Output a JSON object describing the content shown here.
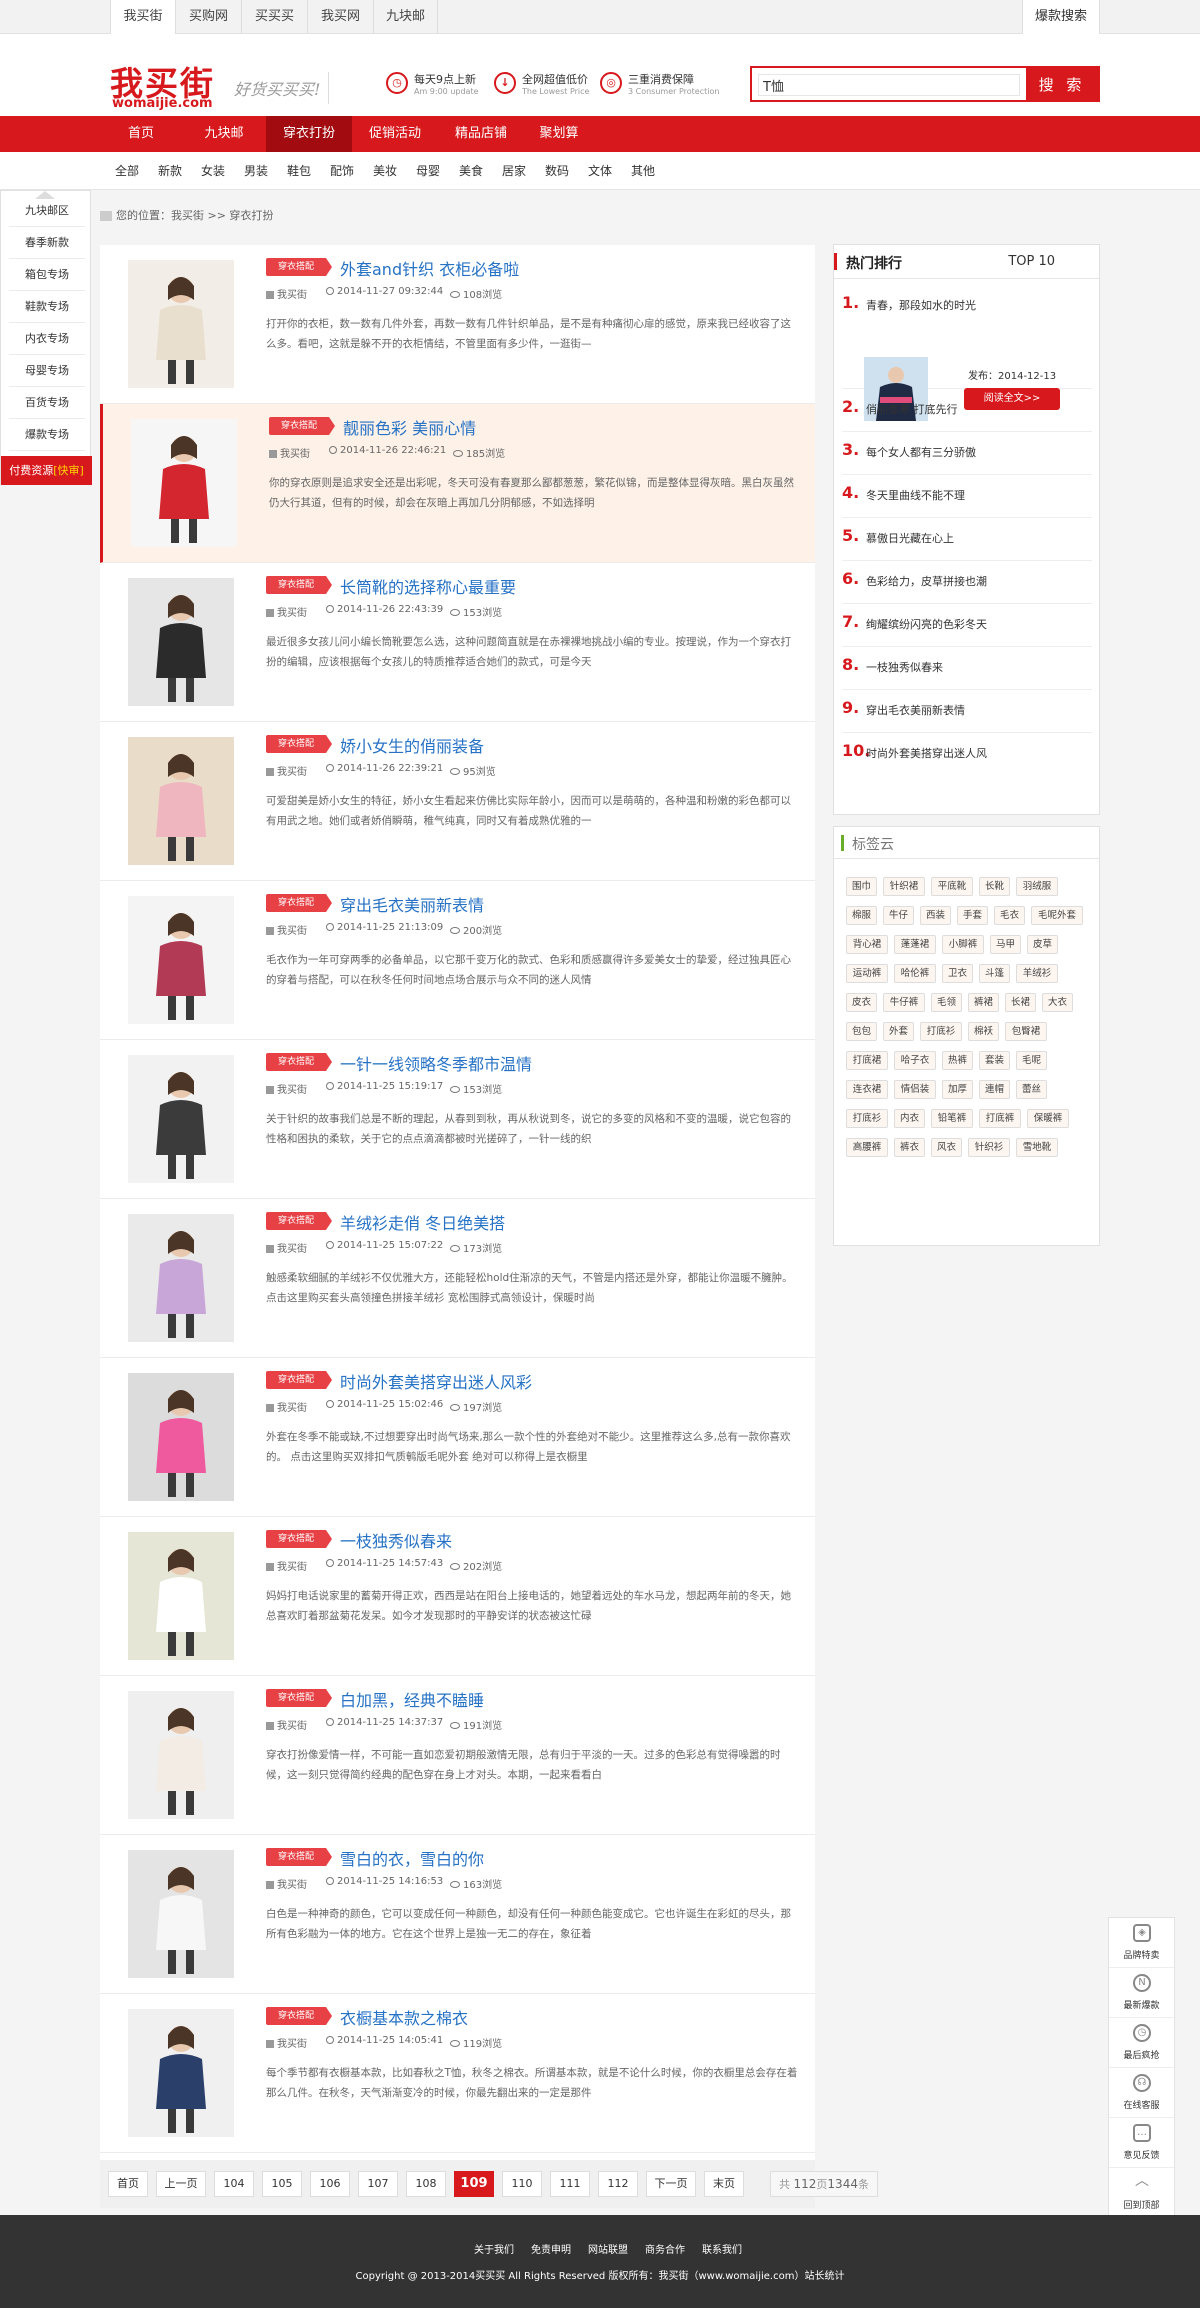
{
  "topbar": {
    "sites": [
      "我买街",
      "买购网",
      "买买买",
      "我买网",
      "九块邮"
    ],
    "hot_search": "爆款搜索"
  },
  "header": {
    "logo_cn": "我买街",
    "logo_en": "womaijie.com",
    "slogan": "好货买买买!",
    "features": [
      {
        "icon": "clock-icon",
        "title": "每天9点上新",
        "sub": "Am 9:00 update"
      },
      {
        "icon": "price-down-icon",
        "title": "全网超值低价",
        "sub": "The Lowest Price"
      },
      {
        "icon": "shield-icon",
        "title": "三重消费保障",
        "sub": "3 Consumer Protection"
      }
    ],
    "search_value": "T恤",
    "search_button": "搜 索"
  },
  "nav": {
    "items": [
      "首页",
      "九块邮",
      "穿衣打扮",
      "促销活动",
      "精品店铺",
      "聚划算"
    ],
    "active_index": 2
  },
  "subnav": [
    "全部",
    "新款",
    "女装",
    "男装",
    "鞋包",
    "配饰",
    "美妆",
    "母婴",
    "美食",
    "居家",
    "数码",
    "文体",
    "其他"
  ],
  "leftfloat": {
    "items": [
      "九块邮区",
      "春季新款",
      "箱包专场",
      "鞋款专场",
      "内衣专场",
      "母婴专场",
      "百货专场",
      "爆款专场"
    ],
    "bottom": "付费资源",
    "bottom_tag": "[快审]"
  },
  "breadcrumb": "您的位置：我买街 >> 穿衣打扮",
  "articles": [
    {
      "badge": "穿衣搭配",
      "title": "外套and针织 衣柜必备啦",
      "author": "我买街",
      "date": "2014-11-27 09:32:44",
      "views": "108浏览",
      "desc": "打开你的衣柜，数一数有几件外套，再数一数有几件针织单品，是不是有种痛彻心扉的感觉，原来我已经收容了这么多。看吧，这就是躲不开的衣柜情结，不管里面有多少件，一逛街—"
    },
    {
      "badge": "穿衣搭配",
      "title": "靓丽色彩 美丽心情",
      "author": "我买街",
      "date": "2014-11-26 22:46:21",
      "views": "185浏览",
      "desc": "你的穿衣原则是追求安全还是出彩呢，冬天可没有春夏那么鄙都葱葱，繁花似锦，而是整体显得灰暗。黑白灰虽然仍大行其道，但有的时候，却会在灰暗上再加几分阴郁感，不如选择明"
    },
    {
      "badge": "穿衣搭配",
      "title": "长筒靴的选择称心最重要",
      "author": "我买街",
      "date": "2014-11-26 22:43:39",
      "views": "153浏览",
      "desc": "最近很多女孩儿问小编长筒靴要怎么选，这种问题简直就是在赤裸裸地挑战小编的专业。按理说，作为一个穿衣打扮的编辑，应该根据每个女孩儿的特质推荐适合她们的款式，可是今天"
    },
    {
      "badge": "穿衣搭配",
      "title": "娇小女生的俏丽装备",
      "author": "我买街",
      "date": "2014-11-26 22:39:21",
      "views": "95浏览",
      "desc": "可爱甜美是娇小女生的特征，娇小女生看起来仿佛比实际年龄小，因而可以是萌萌的，各种温和粉嫩的彩色都可以有用武之地。她们或者娇俏瞬萌，稚气纯真，同时又有着成熟优雅的一"
    },
    {
      "badge": "穿衣搭配",
      "title": "穿出毛衣美丽新表情",
      "author": "我买街",
      "date": "2014-11-25 21:13:09",
      "views": "200浏览",
      "desc": "毛衣作为一年可穿两季的必备单品，以它那千变万化的款式、色彩和质感赢得许多爱美女士的挚爱，经过独具匠心的穿着与搭配，可以在秋冬任何时间地点场合展示与众不同的迷人风情"
    },
    {
      "badge": "穿衣搭配",
      "title": "一针一线领略冬季都市温情",
      "author": "我买街",
      "date": "2014-11-25 15:19:17",
      "views": "153浏览",
      "desc": "关于针织的故事我们总是不断的理起，从春到到秋，再从秋说到冬，说它的多变的风格和不变的温暖，说它包容的性格和困执的柔软，关于它的点点滴滴都被时光搓碎了，一针一线的织"
    },
    {
      "badge": "穿衣搭配",
      "title": "羊绒衫走俏 冬日绝美搭",
      "author": "我买街",
      "date": "2014-11-25 15:07:22",
      "views": "173浏览",
      "desc": "触感柔软细腻的羊绒衫不仅优雅大方，还能轻松hold住渐凉的天气，不管是内搭还是外穿，都能让你温暖不臃肿。 点击这里购买套头高领撞色拼接羊绒衫 宽松围脖式高领设计，保暖时尚"
    },
    {
      "badge": "穿衣搭配",
      "title": "时尚外套美搭穿出迷人风彩",
      "author": "我买街",
      "date": "2014-11-25 15:02:46",
      "views": "197浏览",
      "desc": "外套在冬季不能或缺,不过想要穿出时尚气场来,那么一款个性的外套绝对不能少。这里推荐这么多,总有一款你喜欢的。 点击这里购买双排扣气质鹌版毛呢外套 绝对可以称得上是衣橱里"
    },
    {
      "badge": "穿衣搭配",
      "title": "一枝独秀似春来",
      "author": "我买街",
      "date": "2014-11-25 14:57:43",
      "views": "202浏览",
      "desc": "妈妈打电话说家里的蓄菊开得正欢，西西是站在阳台上接电话的，她望着远处的车水马龙，想起两年前的冬天，她总喜欢盯着那盆菊花发呆。如今才发现那时的平静安详的状态被这忙碌"
    },
    {
      "badge": "穿衣搭配",
      "title": "白加黑，经典不瞌睡",
      "author": "我买街",
      "date": "2014-11-25 14:37:37",
      "views": "191浏览",
      "desc": "穿衣打扮像爱情一样，不可能一直如恋爱初期般激情无限，总有归于平淡的一天。过多的色彩总有觉得噪嚣的时候，这一刻只觉得简约经典的配色穿在身上才对头。本期，一起来看看白"
    },
    {
      "badge": "穿衣搭配",
      "title": "雪白的衣，雪白的你",
      "author": "我买街",
      "date": "2014-11-25 14:16:53",
      "views": "163浏览",
      "desc": "白色是一种神奇的颜色，它可以变成任何一种颜色，却没有任何一种颜色能变成它。它也许诞生在彩虹的尽头，那所有色彩融为一体的地方。它在这个世界上是独一无二的存在，象征着"
    },
    {
      "badge": "穿衣搭配",
      "title": "衣橱基本款之棉衣",
      "author": "我买街",
      "date": "2014-11-25 14:05:41",
      "views": "119浏览",
      "desc": "每个季节都有衣橱基本款，比如春秋之T恤，秋冬之棉衣。所谓基本款，就是不论什么时候，你的衣橱里总会存在着那么几件。在秋冬，天气渐渐变冷的时候，你最先翻出来的一定是那件"
    }
  ],
  "pager": {
    "first": "首页",
    "prev": "上一页",
    "pages": [
      "104",
      "105",
      "106",
      "107",
      "108",
      "109",
      "110",
      "111",
      "112"
    ],
    "current": "109",
    "next": "下一页",
    "last": "末页",
    "total_pre": "共 ",
    "total_pages": "112",
    "total_mid": "页",
    "total_items": "1344",
    "total_suf": "条"
  },
  "hot": {
    "title": "热门排行",
    "right": "TOP 10",
    "first_date": "发布：2014-12-13",
    "first_button": "阅读全文>>",
    "items": [
      {
        "num": "1.",
        "text": "青春，那段如水的时光"
      },
      {
        "num": "2.",
        "text": "俏丽御寒 打底先行"
      },
      {
        "num": "3.",
        "text": "每个女人都有三分骄傲"
      },
      {
        "num": "4.",
        "text": "冬天里曲线不能不理"
      },
      {
        "num": "5.",
        "text": "慕傲日光藏在心上"
      },
      {
        "num": "6.",
        "text": "色彩给力，皮草拼接也潮"
      },
      {
        "num": "7.",
        "text": "绚耀缤纷闪亮的色彩冬天"
      },
      {
        "num": "8.",
        "text": "一枝独秀似春来"
      },
      {
        "num": "9.",
        "text": "穿出毛衣美丽新表情"
      },
      {
        "num": "10.",
        "text": "时尚外套美搭穿出迷人风"
      }
    ]
  },
  "tags": {
    "title": "标签云",
    "items": [
      "围巾",
      "针织裙",
      "平底靴",
      "长靴",
      "羽绒服",
      "棉服",
      "牛仔",
      "西装",
      "手套",
      "毛衣",
      "毛呢外套",
      "背心裙",
      "蓬蓬裙",
      "小脚裤",
      "马甲",
      "皮草",
      "运动裤",
      "哈伦裤",
      "卫衣",
      "斗篷",
      "羊绒衫",
      "皮衣",
      "牛仔裤",
      "毛领",
      "裤裙",
      "长裙",
      "大衣",
      "包包",
      "外套",
      "打底衫",
      "棉袄",
      "包臀裙",
      "打底裙",
      "哈子衣",
      "热裤",
      "套装",
      "毛呢",
      "连衣裙",
      "情侣装",
      "加厚",
      "連帽",
      "蕾丝",
      "打底衫",
      "内衣",
      "铅笔裤",
      "打底裤",
      "保暖裤",
      "高腰裤",
      "裤衣",
      "风衣",
      "针织衫",
      "雪地靴"
    ]
  },
  "rightfloat": [
    "品牌特卖",
    "最新爆款",
    "最后疯抢",
    "在线客服",
    "意见反馈",
    "回到顶部"
  ],
  "footer": {
    "links": [
      "关于我们",
      "免责申明",
      "网站联盟",
      "商务合作",
      "联系我们"
    ],
    "copyright": "Copyright @ 2013-2014买买买 All Rights Reserved 版权所有：我买街（www.womaijie.com）站长统计"
  },
  "colors": {
    "brand": "#d7191d",
    "title_link": "#2672c5",
    "highlight_row": "#fdf1e8"
  }
}
